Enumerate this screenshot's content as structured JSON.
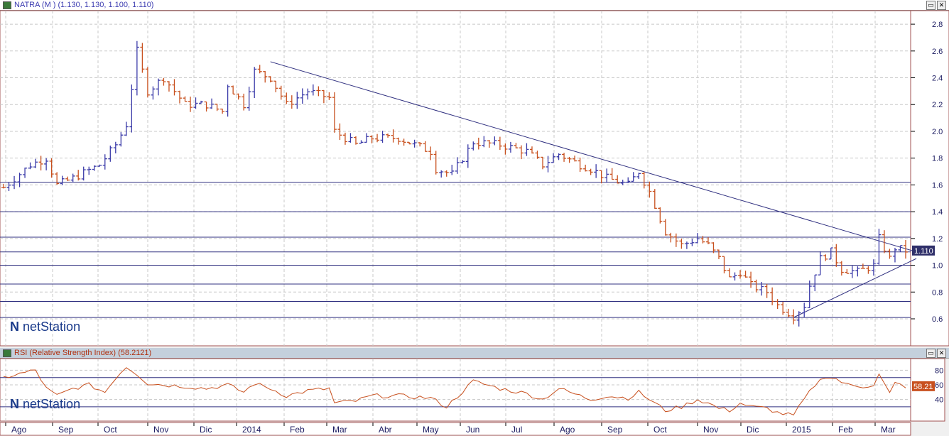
{
  "main_title": "NATRA (M ) (1.130, 1.130, 1.100, 1.110)",
  "rsi_title": "RSI (Relative Strength Index) (58.2121)",
  "logo": "netStation",
  "colors": {
    "up": "#3a3aa8",
    "down": "#c8501e",
    "line": "#303080",
    "rsi": "#c8501e",
    "price_tag": "#30306a",
    "rsi_tag": "#c8501e"
  },
  "chart_data": [
    {
      "type": "ohlc",
      "title": "NATRA (M )",
      "ylim": [
        0.5,
        2.9
      ],
      "yticks": [
        0.6,
        0.8,
        1.0,
        1.2,
        1.4,
        1.6,
        1.8,
        2.0,
        2.2,
        2.4,
        2.6,
        2.8
      ],
      "last_value": "1.110",
      "xticks": [
        "Ago",
        "Sep",
        "Oct",
        "Nov",
        "Dic",
        "2014",
        "Feb",
        "Mar",
        "Abr",
        "May",
        "Jun",
        "Jul",
        "Ago",
        "Sep",
        "Oct",
        "Nov",
        "Dic",
        "2015",
        "Feb",
        "Mar"
      ],
      "bars_count": 170,
      "close_keypoints": [
        [
          0,
          1.58
        ],
        [
          5,
          1.75
        ],
        [
          8,
          1.8
        ],
        [
          10,
          1.6
        ],
        [
          13,
          1.65
        ],
        [
          18,
          1.75
        ],
        [
          21,
          1.9
        ],
        [
          23,
          2.05
        ],
        [
          25,
          2.6
        ],
        [
          27,
          2.3
        ],
        [
          30,
          2.4
        ],
        [
          34,
          2.2
        ],
        [
          38,
          2.2
        ],
        [
          41,
          2.15
        ],
        [
          42,
          2.35
        ],
        [
          45,
          2.2
        ],
        [
          47,
          2.45
        ],
        [
          50,
          2.4
        ],
        [
          53,
          2.2
        ],
        [
          57,
          2.3
        ],
        [
          61,
          2.25
        ],
        [
          62,
          2.0
        ],
        [
          66,
          1.9
        ],
        [
          69,
          1.95
        ],
        [
          74,
          1.95
        ],
        [
          80,
          1.85
        ],
        [
          81,
          1.72
        ],
        [
          84,
          1.68
        ],
        [
          88,
          1.92
        ],
        [
          93,
          1.9
        ],
        [
          98,
          1.85
        ],
        [
          101,
          1.75
        ],
        [
          104,
          1.83
        ],
        [
          108,
          1.75
        ],
        [
          110,
          1.72
        ],
        [
          113,
          1.65
        ],
        [
          117,
          1.6
        ],
        [
          119,
          1.7
        ],
        [
          121,
          1.55
        ],
        [
          124,
          1.25
        ],
        [
          127,
          1.15
        ],
        [
          130,
          1.2
        ],
        [
          132,
          1.15
        ],
        [
          134,
          1.05
        ],
        [
          136,
          0.9
        ],
        [
          138,
          0.95
        ],
        [
          140,
          0.85
        ],
        [
          143,
          0.8
        ],
        [
          145,
          0.7
        ],
        [
          148,
          0.62
        ],
        [
          150,
          0.7
        ],
        [
          151,
          0.85
        ],
        [
          153,
          1.05
        ],
        [
          155,
          1.1
        ],
        [
          157,
          0.97
        ],
        [
          160,
          0.95
        ],
        [
          163,
          1.0
        ],
        [
          164,
          1.2
        ],
        [
          166,
          1.05
        ],
        [
          167,
          1.13
        ],
        [
          169,
          1.11
        ]
      ],
      "horizontal_lines": [
        1.62,
        1.4,
        1.21,
        1.1,
        1.0,
        0.86,
        0.73,
        0.61
      ],
      "trendlines": [
        [
          [
            50,
            2.52
          ],
          [
            171,
            1.1
          ]
        ],
        [
          [
            148,
            0.61
          ],
          [
            171,
            1.05
          ]
        ]
      ]
    },
    {
      "type": "line",
      "title": "RSI (Relative Strength Index)",
      "ylim": [
        10,
        100
      ],
      "yticks": [
        40,
        60,
        80
      ],
      "levels": [
        70,
        30
      ],
      "last_value": "58.21",
      "keypoints": [
        [
          0,
          70
        ],
        [
          3,
          75
        ],
        [
          6,
          80
        ],
        [
          8,
          55
        ],
        [
          10,
          45
        ],
        [
          13,
          55
        ],
        [
          16,
          60
        ],
        [
          19,
          50
        ],
        [
          21,
          70
        ],
        [
          23,
          85
        ],
        [
          25,
          75
        ],
        [
          27,
          62
        ],
        [
          30,
          60
        ],
        [
          34,
          58
        ],
        [
          38,
          55
        ],
        [
          42,
          60
        ],
        [
          45,
          50
        ],
        [
          47,
          62
        ],
        [
          50,
          55
        ],
        [
          53,
          45
        ],
        [
          57,
          52
        ],
        [
          61,
          55
        ],
        [
          62,
          35
        ],
        [
          66,
          38
        ],
        [
          69,
          45
        ],
        [
          74,
          45
        ],
        [
          80,
          42
        ],
        [
          83,
          30
        ],
        [
          88,
          65
        ],
        [
          93,
          55
        ],
        [
          98,
          48
        ],
        [
          101,
          40
        ],
        [
          104,
          55
        ],
        [
          108,
          45
        ],
        [
          110,
          40
        ],
        [
          113,
          45
        ],
        [
          117,
          42
        ],
        [
          119,
          50
        ],
        [
          121,
          40
        ],
        [
          124,
          25
        ],
        [
          127,
          30
        ],
        [
          130,
          40
        ],
        [
          132,
          35
        ],
        [
          134,
          28
        ],
        [
          136,
          25
        ],
        [
          138,
          35
        ],
        [
          140,
          30
        ],
        [
          143,
          28
        ],
        [
          145,
          22
        ],
        [
          148,
          18
        ],
        [
          150,
          40
        ],
        [
          152,
          60
        ],
        [
          154,
          72
        ],
        [
          156,
          68
        ],
        [
          158,
          60
        ],
        [
          161,
          58
        ],
        [
          163,
          60
        ],
        [
          164,
          74
        ],
        [
          166,
          48
        ],
        [
          167,
          62
        ],
        [
          169,
          58
        ]
      ]
    }
  ]
}
